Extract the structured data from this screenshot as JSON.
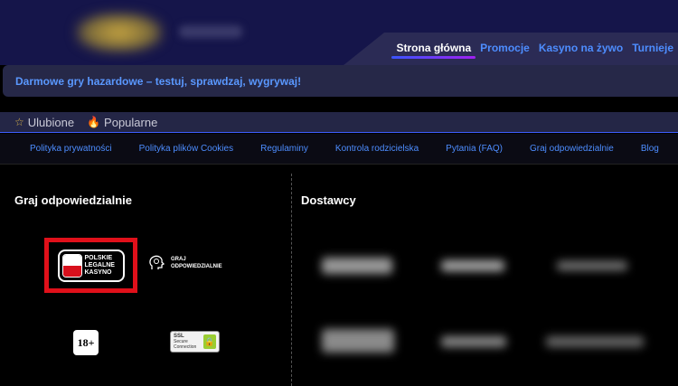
{
  "header": {
    "nav": [
      {
        "label": "Strona główna",
        "active": true
      },
      {
        "label": "Promocje",
        "active": false
      },
      {
        "label": "Kasyno na żywo",
        "active": false
      },
      {
        "label": "Turnieje",
        "active": false
      }
    ]
  },
  "banner": {
    "text": "Darmowe gry hazardowe – testuj, sprawdzaj, wygrywaj!"
  },
  "favorites": {
    "items": [
      {
        "icon": "star-icon",
        "label": "Ulubione"
      },
      {
        "icon": "fire-icon",
        "label": "Popularne"
      }
    ]
  },
  "footer_links": [
    "Polityka prywatności",
    "Polityka plików Cookies",
    "Regulaminy",
    "Kontrola rodzicielska",
    "Pytania (FAQ)",
    "Graj odpowiedzialnie",
    "Blog"
  ],
  "responsible": {
    "title": "Graj odpowiedzialnie",
    "pl_badge": {
      "line1": "POLSKIE",
      "line2": "LEGALNE",
      "line3": "KASYNO"
    },
    "graj_badge": {
      "line1": "GRAJ",
      "line2": "ODPOWIEDZIALNIE"
    },
    "age_badge": "18+",
    "ssl_badge": {
      "line1": "SSL",
      "line2": "Secure",
      "line3": "Connection"
    }
  },
  "providers": {
    "title": "Dostawcy"
  },
  "colors": {
    "accent": "#4d8dff",
    "header_bg": "#15154a",
    "badge_red": "#e0101a"
  }
}
